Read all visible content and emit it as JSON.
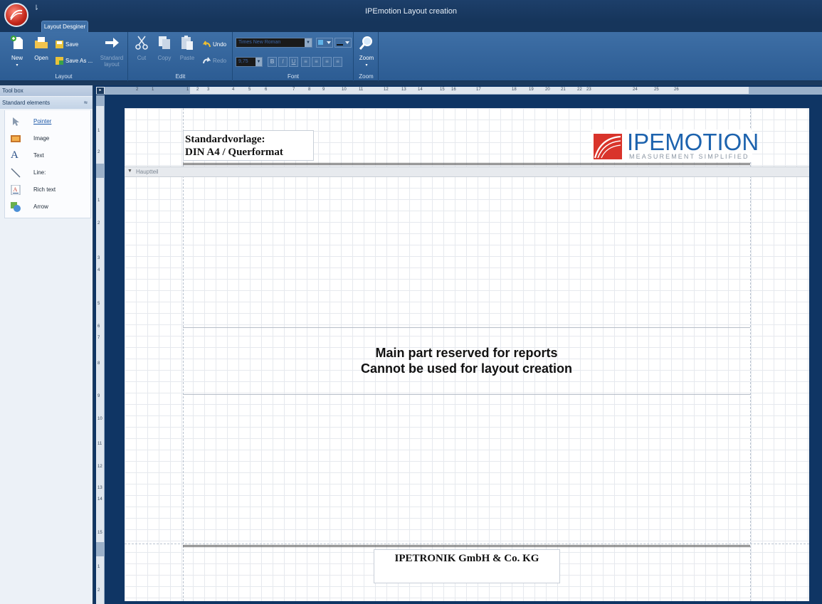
{
  "window": {
    "title": "IPEmotion Layout creation"
  },
  "ribbon": {
    "tab": "Layout Desginer",
    "groups": {
      "layout": {
        "label": "Layout",
        "new": "New",
        "open": "Open",
        "save": "Save",
        "save_as": "Save As ...",
        "standard_layout": "Standard layout"
      },
      "edit": {
        "label": "Edit",
        "cut": "Cut",
        "copy": "Copy",
        "paste": "Paste",
        "undo": "Undo",
        "redo": "Redo"
      },
      "font": {
        "label": "Font",
        "font_name": "Times New Roman",
        "font_size": "9,75",
        "bold": "B",
        "italic": "I",
        "underline": "U"
      },
      "zoom": {
        "label": "Zoom",
        "zoom": "Zoom"
      }
    }
  },
  "toolbox": {
    "header": "Tool box",
    "section": "Standard elements",
    "items": [
      {
        "label": "Pointer",
        "icon": "pointer-icon",
        "selected": true
      },
      {
        "label": "Image",
        "icon": "image-icon"
      },
      {
        "label": "Text",
        "icon": "text-icon"
      },
      {
        "label": "Line:",
        "icon": "line-icon"
      },
      {
        "label": "Rich text",
        "icon": "rich-text-icon"
      },
      {
        "label": "Arrow",
        "icon": "arrow-shape-icon"
      }
    ]
  },
  "rulers": {
    "horizontal": [
      "2",
      "1",
      "1",
      "2",
      "3",
      "4",
      "5",
      "6",
      "7",
      "8",
      "9",
      "10",
      "11",
      "12",
      "13",
      "14",
      "15",
      "16",
      "17",
      "18",
      "19",
      "20",
      "21",
      "22",
      "23",
      "24",
      "25",
      "26"
    ],
    "vertical": [
      "1",
      "2",
      "1",
      "2",
      "3",
      "4",
      "5",
      "6",
      "7",
      "8",
      "9",
      "10",
      "11",
      "12",
      "13",
      "14",
      "15",
      "1",
      "2"
    ]
  },
  "page": {
    "header_title_line1": "Standardvorlage:",
    "header_title_line2": "DIN A4 / Querformat",
    "logo_text": "IPEMOTION",
    "logo_tagline": "MEASUREMENT SIMPLIFIED",
    "band_label": "Hauptteil",
    "reserved_line1": "Main part reserved for reports",
    "reserved_line2": "Cannot be used for layout creation",
    "footer_text": "IPETRONIK GmbH & Co. KG"
  },
  "colors": {
    "window_bg": "#1b3a5e",
    "ribbon": "#3e6fa6",
    "logo_blue": "#1d63ae",
    "logo_red": "#d9342b"
  }
}
